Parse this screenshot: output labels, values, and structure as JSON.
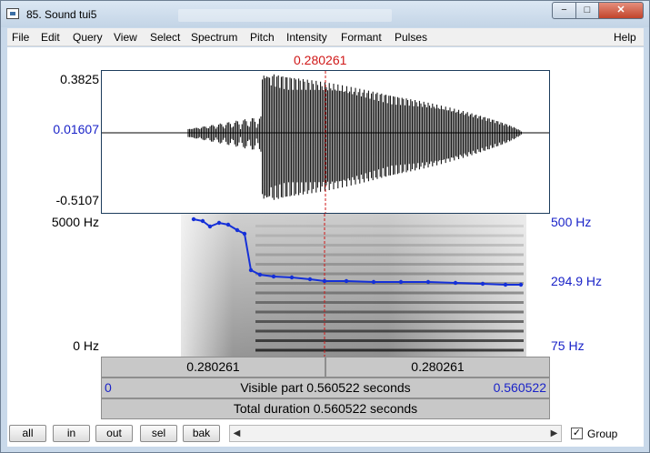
{
  "window": {
    "title": "85. Sound tui5",
    "min_glyph": "−",
    "max_glyph": "□",
    "close_glyph": "✕"
  },
  "menu": [
    "File",
    "Edit",
    "Query",
    "View",
    "Select",
    "Spectrum",
    "Pitch",
    "Intensity",
    "Formant",
    "Pulses"
  ],
  "help_label": "Help",
  "cursor": {
    "time_label": "0.280261"
  },
  "waveform": {
    "max_label": "0.3825",
    "cursor_value_label": "0.01607",
    "min_label": "-0.5107"
  },
  "spectrogram": {
    "top_label": "5000 Hz",
    "bottom_label": "0 Hz"
  },
  "pitch": {
    "top_label": "500 Hz",
    "cursor_label": "294.9 Hz",
    "bottom_label": "75 Hz"
  },
  "bars": {
    "left_segment": "0.280261",
    "right_segment": "0.280261",
    "visible_start": "0",
    "visible_part": "Visible part 0.560522 seconds",
    "visible_end": "0.560522",
    "total_duration": "Total duration 0.560522 seconds"
  },
  "buttons": {
    "all": "all",
    "in": "in",
    "out": "out",
    "sel": "sel",
    "bak": "bak"
  },
  "group_label": "Group",
  "colors": {
    "cursor": "#d01818",
    "pitch_line": "#1530d8",
    "axis_blue": "#1a23c8"
  }
}
